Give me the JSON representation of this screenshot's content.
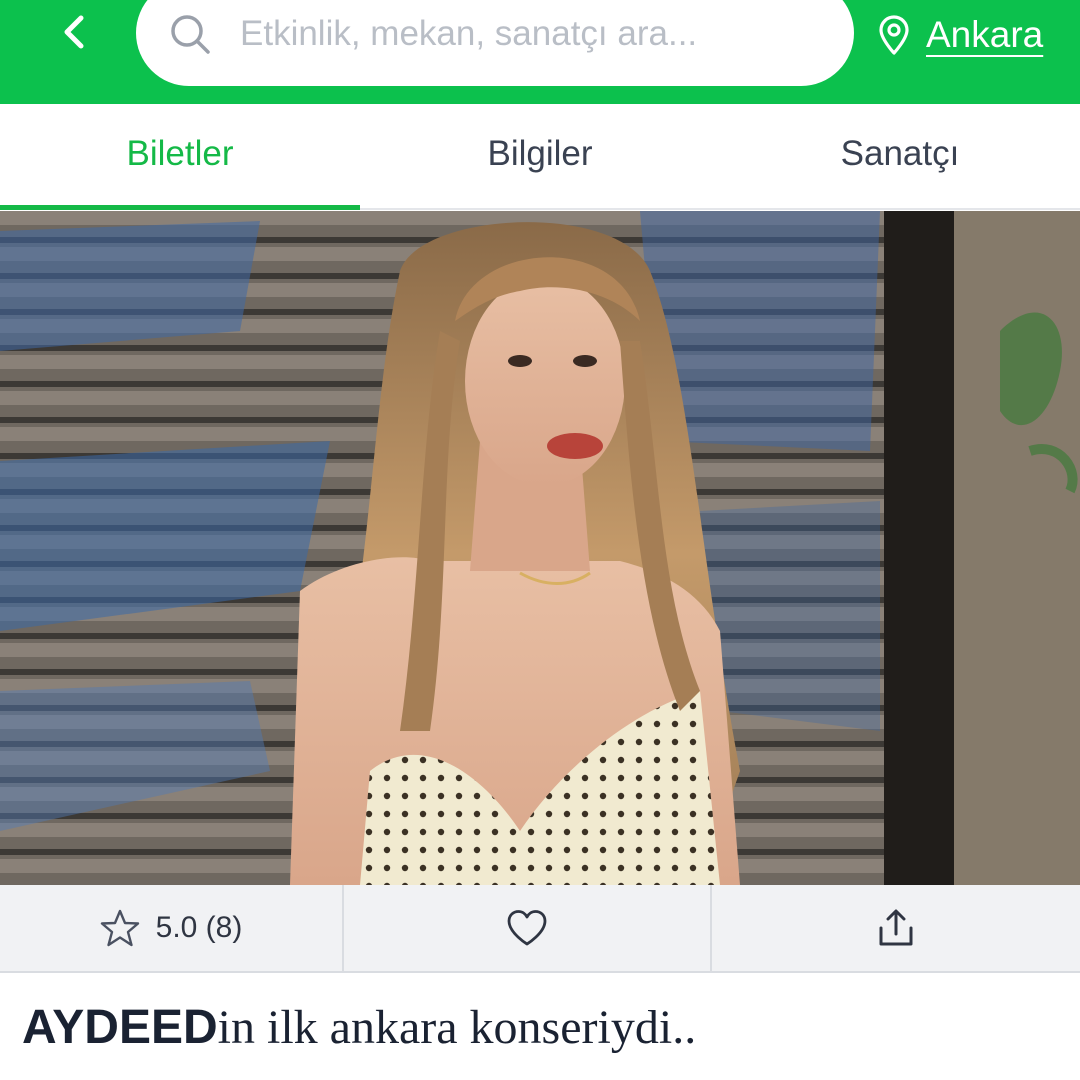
{
  "header": {
    "back_icon": "chevron-left-icon",
    "search": {
      "icon": "search-icon",
      "placeholder": "Etkinlik, mekan, sanatçı ara..."
    },
    "location": {
      "icon": "location-pin-icon",
      "label": "Ankara"
    },
    "colors": {
      "brand": "#0cc14d"
    }
  },
  "tabs": [
    {
      "label": "Biletler",
      "active": true
    },
    {
      "label": "Bilgiler",
      "active": false
    },
    {
      "label": "Sanatçı",
      "active": false
    }
  ],
  "actions": {
    "rating": {
      "icon": "star-outline-icon",
      "text": "5.0 (8)"
    },
    "favorite": {
      "icon": "heart-outline-icon"
    },
    "share": {
      "icon": "share-icon"
    }
  },
  "post": {
    "title_bold": "AYDEED",
    "title_rest": "in ilk ankara konseriydi.."
  }
}
